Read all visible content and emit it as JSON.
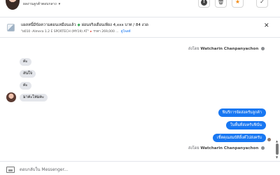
{
  "header": {
    "status_label": "ผลงานลูกค้าตอบกลาง",
    "status_caret": "▾",
    "buttons": [
      {
        "name": "info-button",
        "icon": "!"
      },
      {
        "name": "delete-button",
        "icon": "🗑"
      },
      {
        "name": "star-button",
        "icon": "★"
      },
      {
        "name": "mark-done-button",
        "icon": "✓"
      }
    ]
  },
  "product_card": {
    "title_part1": "แผลหนี้มีข้อความตอนเหมือนแล้ว",
    "title_part2": "ผ่อนจริงเดือนเพียง 4,xxx บาท / 84 งวด",
    "subtitle_part1": "\"ผ010 -Almera 1.2 E SPORTECH (MY19) AT\"",
    "subtitle_part2": "ราคา 269,000 ...",
    "link": "ดูโพสต์",
    "close": "✕"
  },
  "messages": {
    "sent_by_prefix": "ส่งโดย",
    "sent_by_name": "Watcharin Chanpanyachon",
    "incoming": [
      "ค่ะ",
      "สนใจ",
      "ค่ะ",
      "มาค่ะไหมคะ"
    ],
    "outgoing": [
      "ฟินรีการจัดส่งครับลูกค้า",
      "ในพื้นที่ส่งครับฟินั่น",
      "เชิ้ตคุณสมบัติลิ้งค์ไปส่งครับ"
    ]
  },
  "composer": {
    "placeholder": "ตอบกลับใน Messenger..."
  }
}
